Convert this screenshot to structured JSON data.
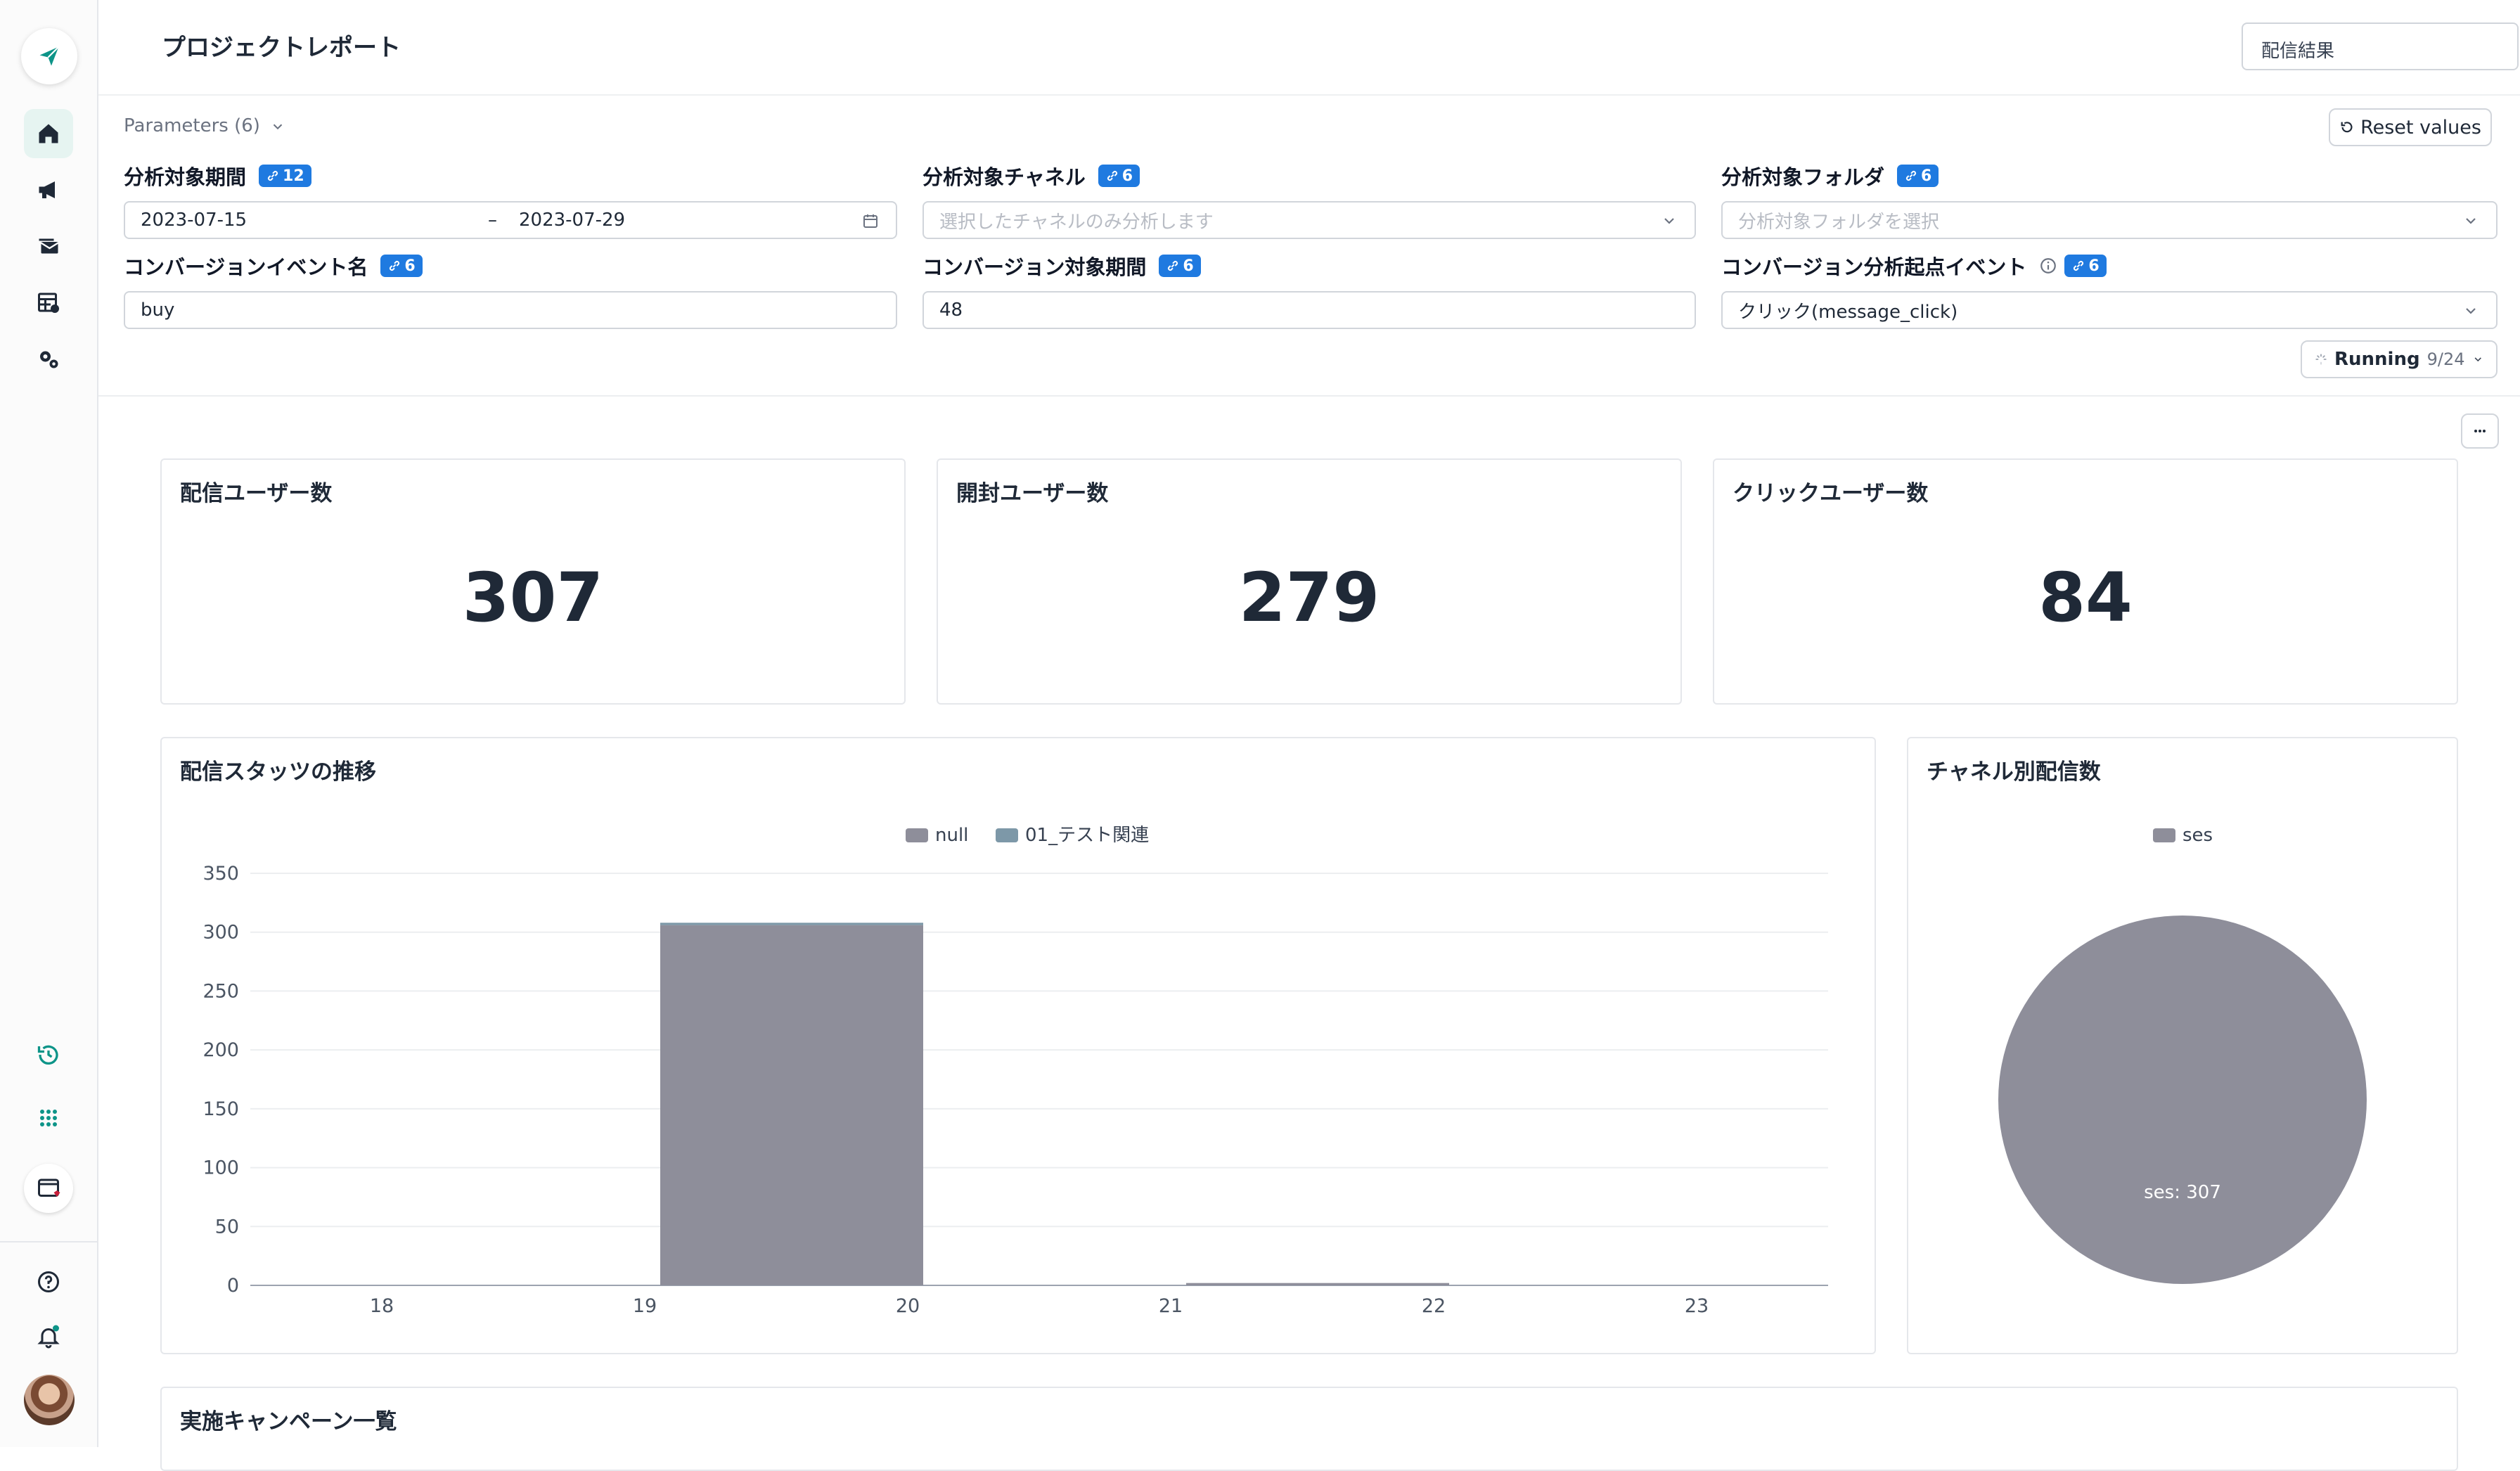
{
  "app": {
    "page_title": "プロジェクトレポート",
    "top_select_value": "配信結果"
  },
  "parameters": {
    "title": "Parameters (6)",
    "reset_label": "Reset values",
    "fields": [
      {
        "label": "分析対象期間",
        "badge": "12",
        "type": "daterange",
        "from": "2023-07-15",
        "sep": "–",
        "to": "2023-07-29"
      },
      {
        "label": "分析対象チャネル",
        "badge": "6",
        "type": "select",
        "placeholder": "選択したチャネルのみ分析します"
      },
      {
        "label": "分析対象フォルダ",
        "badge": "6",
        "type": "select",
        "placeholder": "分析対象フォルダを選択"
      },
      {
        "label": "コンバージョンイベント名",
        "badge": "6",
        "type": "text",
        "value": "buy"
      },
      {
        "label": "コンバージョン対象期間",
        "badge": "6",
        "type": "text",
        "value": "48"
      },
      {
        "label": "コンバージョン分析起点イベント",
        "badge": "6",
        "type": "select",
        "value": "クリック(message_click)"
      }
    ],
    "running": {
      "label": "Running",
      "progress": "9/24"
    }
  },
  "kpis": [
    {
      "title": "配信ユーザー数",
      "value": "307"
    },
    {
      "title": "開封ユーザー数",
      "value": "279"
    },
    {
      "title": "クリックユーザー数",
      "value": "84"
    }
  ],
  "bar_card": {
    "title": "配信スタッツの推移"
  },
  "pie_card": {
    "title": "チャネル別配信数"
  },
  "campaign_card": {
    "title": "実施キャンペーン一覧"
  },
  "colors": {
    "accent": "#1f7ae0",
    "teal": "#0d9488",
    "null_series": "#8e8e9a",
    "test_series": "#7d98a8",
    "pie": "#8e8e9a"
  },
  "chart_data": [
    {
      "type": "bar",
      "categories": [
        "18",
        "19",
        "20",
        "21",
        "22",
        "23"
      ],
      "bar_slots": [
        "19-20",
        "21-22"
      ],
      "series": [
        {
          "name": "null",
          "values": [
            306,
            2
          ]
        },
        {
          "name": "01_テスト関連",
          "values": [
            2,
            0
          ]
        }
      ],
      "ylim": [
        0,
        350
      ],
      "yticks": [
        0,
        50,
        100,
        150,
        200,
        250,
        300,
        350
      ],
      "grid": true,
      "legend": "top-center",
      "stacked": true
    },
    {
      "type": "pie",
      "labels": [
        "ses"
      ],
      "values": [
        307
      ],
      "data_labels": [
        "ses: 307"
      ],
      "legend": "top-center"
    }
  ]
}
